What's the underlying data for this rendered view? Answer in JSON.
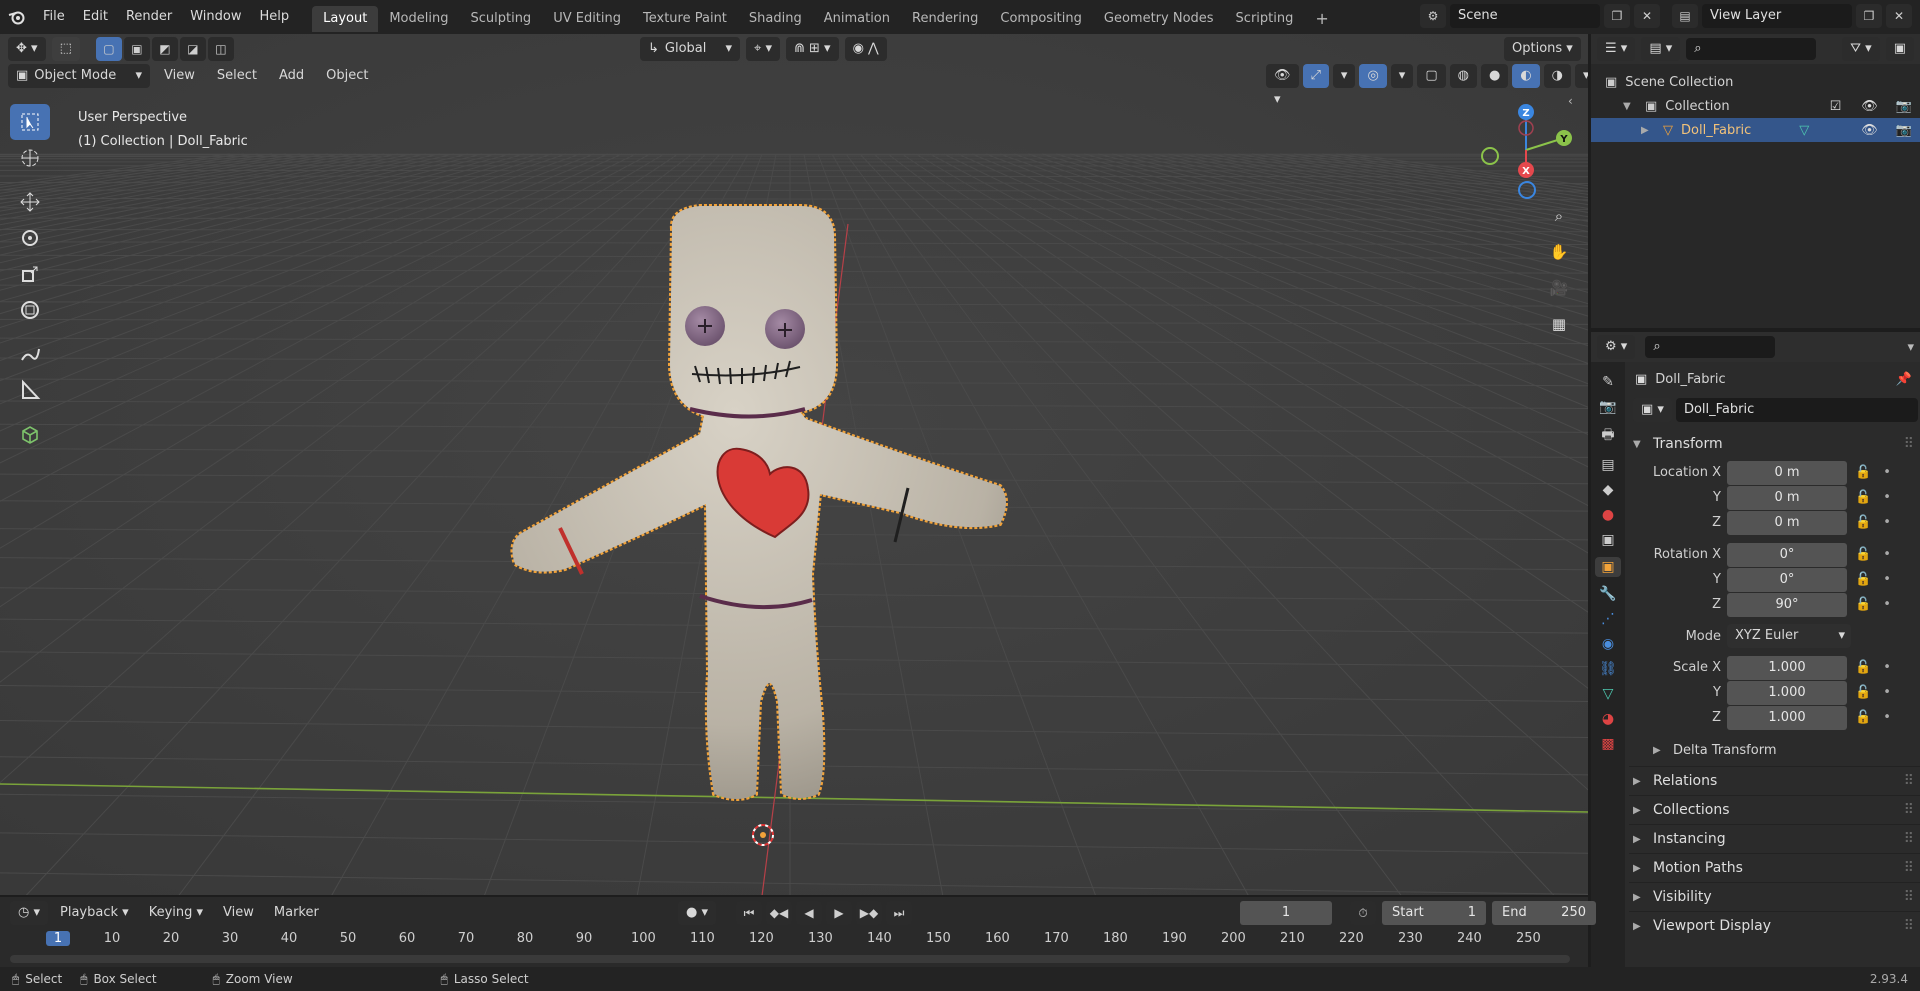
{
  "top_menu": [
    "File",
    "Edit",
    "Render",
    "Window",
    "Help"
  ],
  "workspaces": [
    "Layout",
    "Modeling",
    "Sculpting",
    "UV Editing",
    "Texture Paint",
    "Shading",
    "Animation",
    "Rendering",
    "Compositing",
    "Geometry Nodes",
    "Scripting"
  ],
  "scene": {
    "name": "Scene",
    "view_layer": "View Layer"
  },
  "header": {
    "orientation": "Global",
    "options": "Options",
    "mode": "Object Mode",
    "menus": [
      "View",
      "Select",
      "Add",
      "Object"
    ]
  },
  "viewport": {
    "perspective": "User Perspective",
    "collection_info": "(1) Collection | Doll_Fabric",
    "gizmo": {
      "z": "Z",
      "y": "Y",
      "x": "X"
    }
  },
  "outliner": {
    "root": "Scene Collection",
    "collection": "Collection",
    "object": "Doll_Fabric"
  },
  "properties": {
    "object_name_top": "Doll_Fabric",
    "object_name": "Doll_Fabric",
    "transform_title": "Transform",
    "location": {
      "label": "Location X",
      "x": "0 m",
      "y": "0 m",
      "z": "0 m"
    },
    "rotation": {
      "label": "Rotation X",
      "x": "0°",
      "y": "0°",
      "z": "90°"
    },
    "mode_label": "Mode",
    "mode_value": "XYZ Euler",
    "scale": {
      "label": "Scale X",
      "x": "1.000",
      "y": "1.000",
      "z": "1.000"
    },
    "axis_y": "Y",
    "axis_z": "Z",
    "delta": "Delta Transform",
    "panels": [
      "Relations",
      "Collections",
      "Instancing",
      "Motion Paths",
      "Visibility",
      "Viewport Display"
    ]
  },
  "timeline": {
    "menus": [
      "Playback",
      "Keying",
      "View",
      "Marker"
    ],
    "current_frame": "1",
    "start_label": "Start",
    "start": "1",
    "end_label": "End",
    "end": "250",
    "ruler": [
      "1",
      "10",
      "20",
      "30",
      "40",
      "50",
      "60",
      "70",
      "80",
      "90",
      "100",
      "110",
      "120",
      "130",
      "140",
      "150",
      "160",
      "170",
      "180",
      "190",
      "200",
      "210",
      "220",
      "230",
      "240",
      "250"
    ]
  },
  "status": {
    "select": "Select",
    "box_select": "Box Select",
    "zoom_view": "Zoom View",
    "lasso_select": "Lasso Select",
    "version": "2.93.4"
  },
  "colors": {
    "accent": "#4772b3",
    "selection_outline": "#f2a33a",
    "axis_x": "#e5484d",
    "axis_y": "#8bc34a",
    "axis_z": "#3a86e0"
  }
}
